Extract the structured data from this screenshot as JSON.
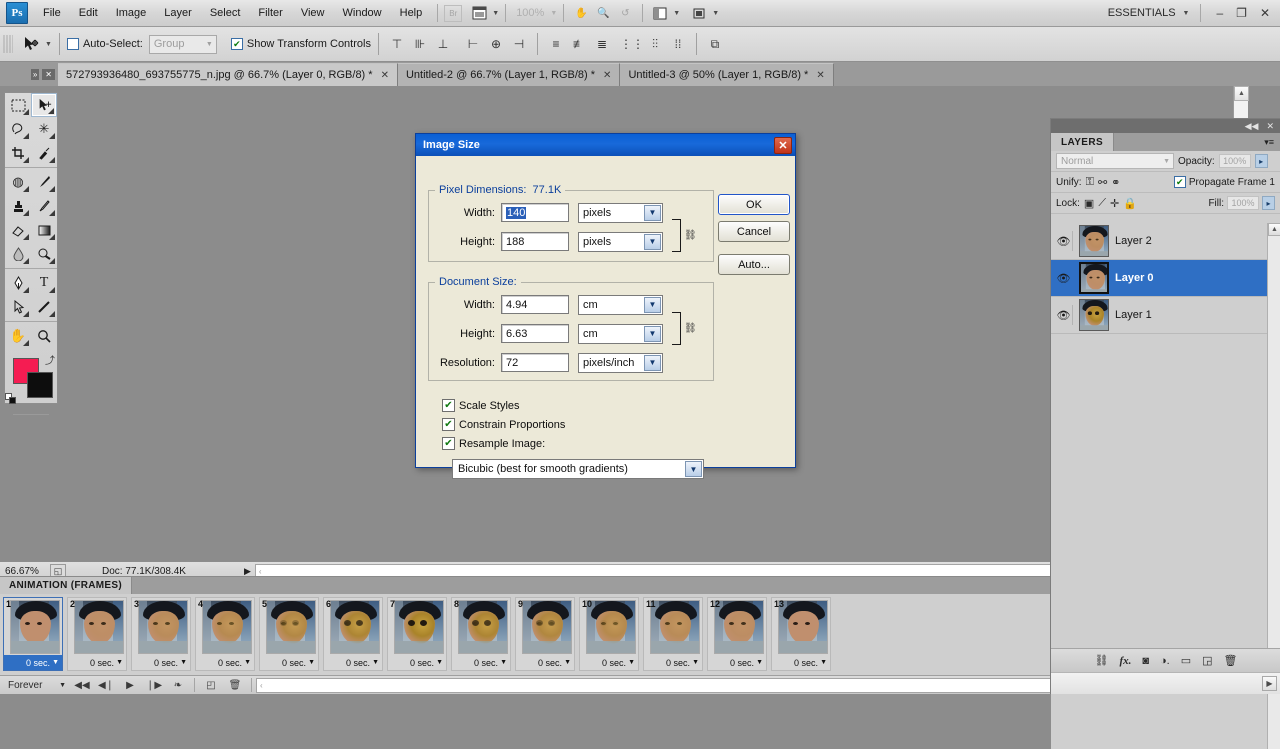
{
  "app": {
    "logo": "Ps",
    "workspace": "ESSENTIALS",
    "zoom_display": "100%"
  },
  "menubar": {
    "items": [
      "File",
      "Edit",
      "Image",
      "Layer",
      "Select",
      "Filter",
      "View",
      "Window",
      "Help"
    ],
    "bridge_icon": "Br",
    "mini_bridge_icon": "mini-bridge-icon",
    "view_extras_icon": "view-extras-icon",
    "screen_mode_icon": "screen-mode-icon",
    "hand_icon": "hand-tool-icon",
    "zoom_icon": "zoom-tool-icon",
    "rotate_icon": "rotate-view-icon",
    "minimize": "–",
    "restore": "❐",
    "close": "✕"
  },
  "optionsbar": {
    "tool_icon": "move-tool-icon",
    "auto_select_label": "Auto-Select:",
    "auto_select_checked": false,
    "auto_select_value": "Group",
    "show_transform_label": "Show Transform Controls",
    "show_transform_checked": true,
    "align_icons": [
      "align-top-edges-icon",
      "align-vertical-centers-icon",
      "align-bottom-edges-icon",
      "align-left-edges-icon",
      "align-horizontal-centers-icon",
      "align-right-edges-icon",
      "distribute-top-edges-icon",
      "distribute-vertical-centers-icon",
      "distribute-bottom-edges-icon",
      "distribute-left-edges-icon",
      "distribute-horizontal-centers-icon",
      "distribute-right-edges-icon",
      "auto-align-layers-icon"
    ]
  },
  "tabs": [
    {
      "label": "572793936480_693755775_n.jpg @ 66.7% (Layer 0, RGB/8) *",
      "active": true
    },
    {
      "label": "Untitled-2 @ 66.7% (Layer 1, RGB/8) *",
      "active": false
    },
    {
      "label": "Untitled-3 @ 50% (Layer 1, RGB/8) *",
      "active": false
    }
  ],
  "toolbar": {
    "tools": [
      {
        "name": "rectangular-marquee-tool",
        "glyph": "▭",
        "selected": false
      },
      {
        "name": "move-tool",
        "glyph": "⌖",
        "selected": true
      },
      {
        "name": "lasso-tool",
        "glyph": "⌁",
        "selected": false
      },
      {
        "name": "magic-wand-tool",
        "glyph": "✳",
        "selected": false
      },
      {
        "name": "crop-tool",
        "glyph": "⌗",
        "selected": false
      },
      {
        "name": "eyedropper-tool",
        "glyph": "⚲",
        "selected": false
      },
      {
        "name": "spot-healing-brush-tool",
        "glyph": "◍",
        "selected": false
      },
      {
        "name": "brush-tool",
        "glyph": "⟋",
        "selected": false
      },
      {
        "name": "clone-stamp-tool",
        "glyph": "⚱",
        "selected": false
      },
      {
        "name": "history-brush-tool",
        "glyph": "⌫",
        "selected": false
      },
      {
        "name": "eraser-tool",
        "glyph": "▱",
        "selected": false
      },
      {
        "name": "gradient-tool",
        "glyph": "◪",
        "selected": false
      },
      {
        "name": "blur-tool",
        "glyph": "💧",
        "selected": false
      },
      {
        "name": "dodge-tool",
        "glyph": "◠",
        "selected": false
      },
      {
        "name": "pen-tool",
        "glyph": "✒",
        "selected": false
      },
      {
        "name": "type-tool",
        "glyph": "T",
        "selected": false
      },
      {
        "name": "path-selection-tool",
        "glyph": "➤",
        "selected": false
      },
      {
        "name": "line-tool",
        "glyph": "╲",
        "selected": false
      },
      {
        "name": "hand-tool",
        "glyph": "✋",
        "selected": false
      },
      {
        "name": "zoom-tool",
        "glyph": "🔍",
        "selected": false
      }
    ],
    "foreground_color": "#f51c52",
    "background_color": "#0d0d0d",
    "swap_icon": "swap-colors-icon",
    "default_colors_icon": "default-colors-icon"
  },
  "dialog": {
    "title": "Image Size",
    "close_icon": "close-icon",
    "pixel_group": {
      "legend_label": "Pixel Dimensions:",
      "legend_value": "77.1K",
      "width_label": "Width:",
      "width_value": "140",
      "width_unit": "pixels",
      "height_label": "Height:",
      "height_value": "188",
      "height_unit": "pixels",
      "link_icon": "constrain-link-icon"
    },
    "document_group": {
      "legend_label": "Document Size:",
      "width_label": "Width:",
      "width_value": "4.94",
      "width_unit": "cm",
      "height_label": "Height:",
      "height_value": "6.63",
      "height_unit": "cm",
      "resolution_label": "Resolution:",
      "resolution_value": "72",
      "resolution_unit": "pixels/inch",
      "link_icon": "constrain-link-icon"
    },
    "checkboxes": [
      {
        "label": "Scale Styles",
        "checked": true
      },
      {
        "label": "Constrain Proportions",
        "checked": true
      },
      {
        "label": "Resample Image:",
        "checked": true
      }
    ],
    "resample_value": "Bicubic (best for smooth gradients)",
    "buttons": [
      {
        "label": "OK",
        "focused": true
      },
      {
        "label": "Cancel",
        "focused": false
      },
      {
        "label": "Auto...",
        "focused": false
      }
    ]
  },
  "statusbar": {
    "zoom": "66.67%",
    "thumb_icon": "document-thumb-icon",
    "doc_info": "Doc: 77.1K/308.4K",
    "arrow_icon": "status-arrow-icon"
  },
  "animation": {
    "panel_title": "ANIMATION (FRAMES)",
    "menu_icon": "panel-menu-icon",
    "frames": [
      {
        "number": "1",
        "delay": "0 sec.",
        "selected": true,
        "morph": 0.0
      },
      {
        "number": "2",
        "delay": "0 sec.",
        "selected": false,
        "morph": 0.12
      },
      {
        "number": "3",
        "delay": "0 sec.",
        "selected": false,
        "morph": 0.28
      },
      {
        "number": "4",
        "delay": "0 sec.",
        "selected": false,
        "morph": 0.42
      },
      {
        "number": "5",
        "delay": "0 sec.",
        "selected": false,
        "morph": 0.6
      },
      {
        "number": "6",
        "delay": "0 sec.",
        "selected": false,
        "morph": 0.85
      },
      {
        "number": "7",
        "delay": "0 sec.",
        "selected": false,
        "morph": 1.0
      },
      {
        "number": "8",
        "delay": "0 sec.",
        "selected": false,
        "morph": 0.85
      },
      {
        "number": "9",
        "delay": "0 sec.",
        "selected": false,
        "morph": 0.68
      },
      {
        "number": "10",
        "delay": "0 sec.",
        "selected": false,
        "morph": 0.48
      },
      {
        "number": "11",
        "delay": "0 sec.",
        "selected": false,
        "morph": 0.32
      },
      {
        "number": "12",
        "delay": "0 sec.",
        "selected": false,
        "morph": 0.16
      },
      {
        "number": "13",
        "delay": "0 sec.",
        "selected": false,
        "morph": 0.04
      }
    ],
    "loop_value": "Forever",
    "controls": [
      "select-first-frame-icon",
      "select-previous-frame-icon",
      "play-animation-icon",
      "select-next-frame-icon",
      "tween-frames-icon",
      "duplicate-frame-icon",
      "delete-frame-icon"
    ]
  },
  "layers_panel": {
    "collapse_icon": "collapse-panel-icon",
    "close_icon": "close-panel-icon",
    "tab_label": "LAYERS",
    "menu_icon": "panel-menu-icon",
    "blend_mode": "Normal",
    "opacity_label": "Opacity:",
    "opacity_value": "100%",
    "unify_label": "Unify:",
    "unify_icons": [
      "unify-position-icon",
      "unify-visibility-icon",
      "unify-style-icon"
    ],
    "propagate_label": "Propagate Frame 1",
    "propagate_checked": true,
    "lock_label": "Lock:",
    "lock_icons": [
      "lock-transparent-pixels-icon",
      "lock-image-pixels-icon",
      "lock-position-icon",
      "lock-all-icon"
    ],
    "fill_label": "Fill:",
    "fill_value": "100%",
    "layers": [
      {
        "name": "Layer 2",
        "visible": true,
        "active": false,
        "kind": "face"
      },
      {
        "name": "Layer 0",
        "visible": true,
        "active": true,
        "kind": "face-dark"
      },
      {
        "name": "Layer 1",
        "visible": true,
        "active": false,
        "kind": "skull"
      }
    ],
    "footer_icons": [
      "link-layers-icon",
      "layer-style-icon",
      "layer-mask-icon",
      "adjustment-layer-icon",
      "new-group-icon",
      "new-layer-icon",
      "delete-layer-icon"
    ]
  },
  "colors": {
    "title_blue": "#0a5fd4",
    "selection_blue": "#2f6fc4",
    "dialog_bg": "#ece9d8",
    "panel_gray": "#cfcfcf",
    "canvas_gray": "#8c8c8c"
  }
}
